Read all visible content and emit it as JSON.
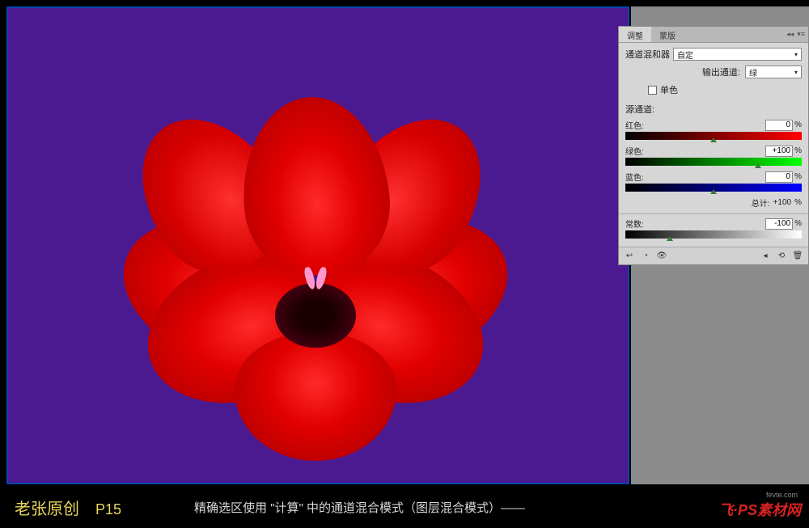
{
  "canvas": {
    "bg_color": "#4b1a91",
    "subject": "red-flower"
  },
  "panel": {
    "tabs": {
      "active": "调整",
      "inactive": "蒙版"
    },
    "adjustment_name": "通道混和器",
    "preset": "自定",
    "output_channel_label": "输出通道:",
    "output_channel_value": "绿",
    "monochrome_label": "单色",
    "monochrome_checked": false,
    "source_channels_label": "源通道:",
    "channels": {
      "red": {
        "label": "红色:",
        "value": "0",
        "unit": "%"
      },
      "green": {
        "label": "绿色:",
        "value": "+100",
        "unit": "%"
      },
      "blue": {
        "label": "蓝色:",
        "value": "0",
        "unit": "%"
      }
    },
    "total": {
      "label": "总计:",
      "value": "+100",
      "unit": "%"
    },
    "constant": {
      "label": "常数:",
      "value": "-100",
      "unit": "%"
    }
  },
  "footer": {
    "author": "老张原创",
    "page": "P15",
    "caption": "精确选区使用 \"计算\" 中的通道混合模式（图层混合模式）——",
    "watermark_top": "fevte.com",
    "watermark_main": "飞·PS素材网"
  }
}
